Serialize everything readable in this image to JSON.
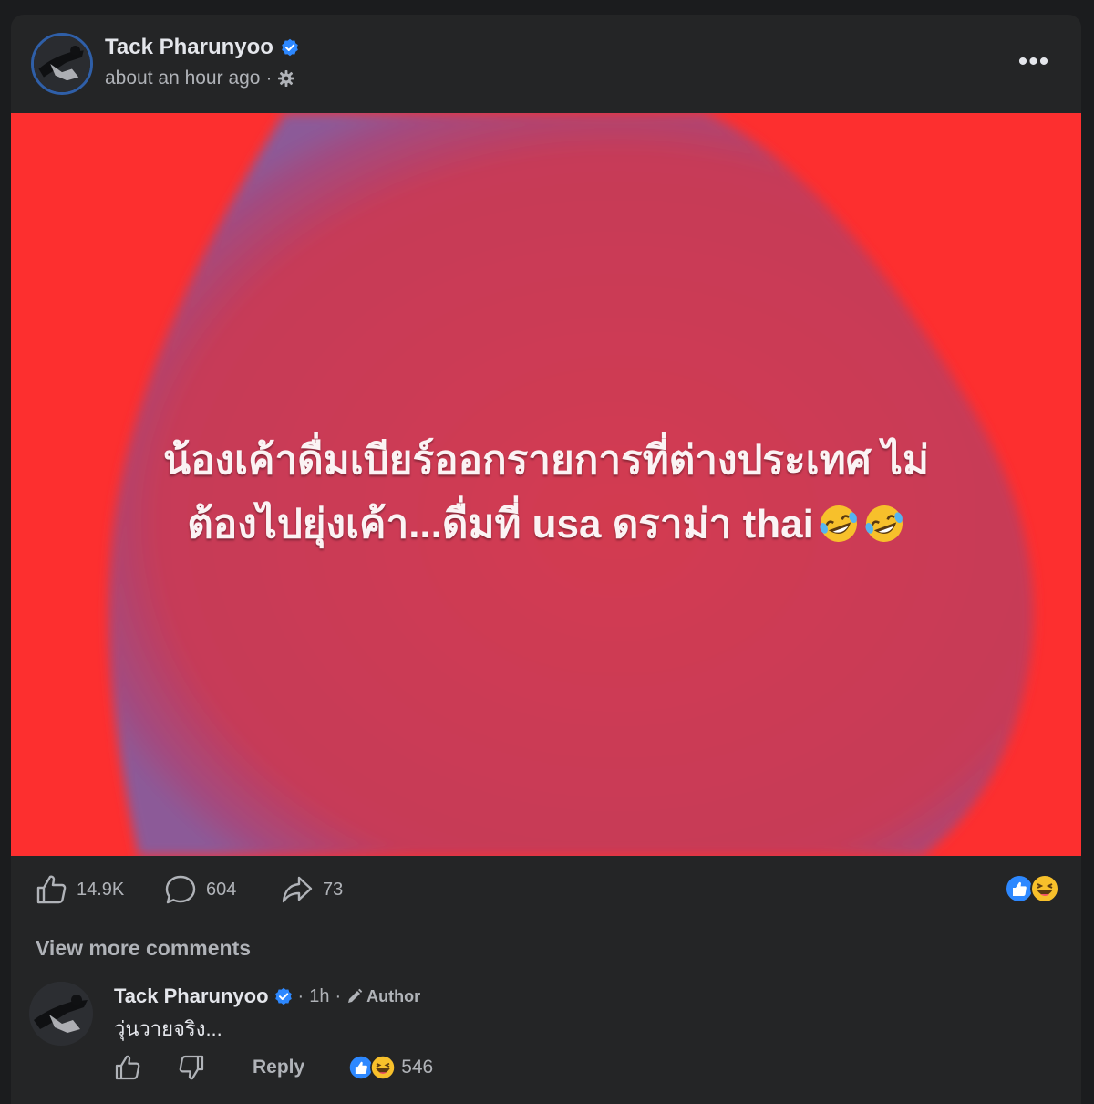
{
  "post": {
    "author": "Tack Pharunyoo",
    "timestamp": "about an hour ago",
    "meta_separator": "·",
    "privacy_icon": "gear-icon",
    "more_label": "•••",
    "text_line1": "น้องเค้าดื่มเบียร์ออกรายการที่ต่างประเทศ ไม่",
    "text_line2": "ต้องไปยุ่งเค้า...ดื่มที่ usa ดราม่า thai",
    "background_color": "#fd2f2f",
    "blob_color": "#c83a57"
  },
  "actions": {
    "likes": "14.9K",
    "comments": "604",
    "shares": "73",
    "reactions": [
      "like-reaction-icon",
      "haha-reaction-icon"
    ]
  },
  "comments": {
    "view_more_label": "View more comments",
    "items": [
      {
        "author": "Tack Pharunyoo",
        "time": "1h",
        "separator": "·",
        "badge": "Author",
        "text": "วุ่นวายจริง...",
        "reply_label": "Reply",
        "reaction_count": "546"
      }
    ]
  },
  "colors": {
    "card_bg": "#242526",
    "page_bg": "#1b1c1e",
    "verified_blue": "#2d88ff",
    "text_primary": "#e4e6eb",
    "text_secondary": "#b0b3b8"
  }
}
